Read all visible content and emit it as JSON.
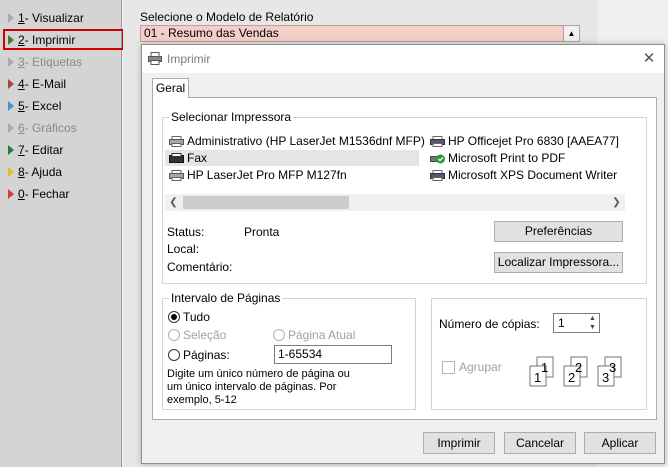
{
  "menu": {
    "items": [
      {
        "num": "1",
        "label": " - Visualizar",
        "disabled": false,
        "color": "#aaaaaa"
      },
      {
        "num": "2",
        "label": " - Imprimir",
        "disabled": false,
        "color": "#4a7a2a"
      },
      {
        "num": "3",
        "label": " - Etiquetas",
        "disabled": true,
        "color": "#aaaaaa"
      },
      {
        "num": "4",
        "label": " - E-Mail",
        "disabled": false,
        "color": "#b04040"
      },
      {
        "num": "5",
        "label": " - Excel",
        "disabled": false,
        "color": "#3a9ad0"
      },
      {
        "num": "6",
        "label": " - Gráficos",
        "disabled": true,
        "color": "#aaaaaa"
      },
      {
        "num": "7",
        "label": " - Editar",
        "disabled": false,
        "color": "#2a7a3a"
      },
      {
        "num": "8",
        "label": " - Ajuda",
        "disabled": false,
        "color": "#e0c020"
      },
      {
        "num": "0",
        "label": " - Fechar",
        "disabled": false,
        "color": "#d04040"
      }
    ]
  },
  "report": {
    "label": "Selecione o Modelo de Relatório",
    "selected": "01 - Resumo das Vendas"
  },
  "dialog": {
    "title": "Imprimir",
    "tab": "Geral",
    "printers_group": "Selecionar Impressora",
    "printers": [
      {
        "name": "Administrativo (HP LaserJet M1536dnf MFP)",
        "selected": false
      },
      {
        "name": "HP Officejet Pro 6830 [AAEA77]",
        "selected": false
      },
      {
        "name": "Fax",
        "selected": true
      },
      {
        "name": "Microsoft Print to PDF",
        "selected": false
      },
      {
        "name": "HP LaserJet Pro MFP M127fn",
        "selected": false
      },
      {
        "name": "Microsoft XPS Document Writer",
        "selected": false
      }
    ],
    "status_label": "Status:",
    "status_value": "Pronta",
    "local_label": "Local:",
    "comment_label": "Comentário:",
    "preferences_btn": "Preferências",
    "find_printer_btn": "Localizar Impressora...",
    "range_group": "Intervalo de Páginas",
    "range_all": "Tudo",
    "range_selection": "Seleção",
    "range_current": "Página Atual",
    "range_pages": "Páginas:",
    "pages_value": "1-65534",
    "range_hint": "Digite um único número de página ou um único intervalo de páginas. Por exemplo, 5-12",
    "copies_label": "Número de cópias:",
    "copies_value": "1",
    "collate_label": "Agrupar",
    "collate_pages": [
      "1",
      "1",
      "2",
      "2",
      "3",
      "3"
    ],
    "print_btn": "Imprimir",
    "cancel_btn": "Cancelar",
    "apply_btn": "Aplicar"
  }
}
